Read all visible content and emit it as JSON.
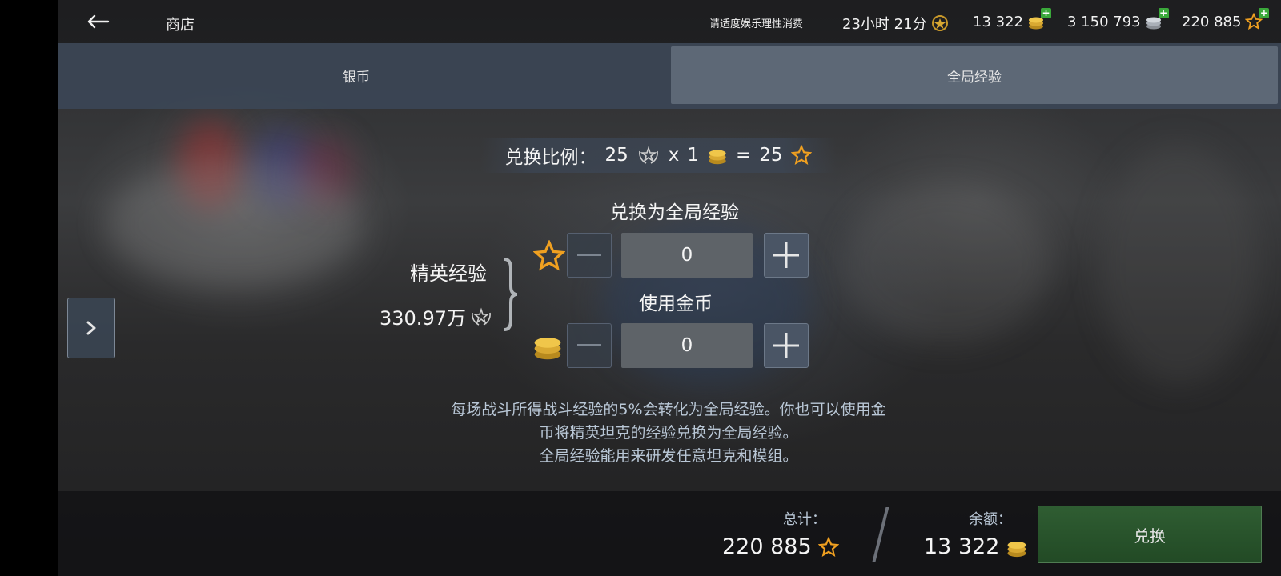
{
  "header": {
    "title": "商店",
    "notice": "请适度娱乐理性消费",
    "timer": "23小时 21分",
    "gold": "13 322",
    "silver": "3 150 793",
    "free_xp": "220 885"
  },
  "tabs": [
    {
      "label": "银币",
      "active": false
    },
    {
      "label": "全局经验",
      "active": true
    }
  ],
  "rate": {
    "label": "兑换比例：",
    "xp_amount": "25",
    "times": "x",
    "gold_amount": "1",
    "equals": "=",
    "result": "25"
  },
  "convert": {
    "heading_xp": "兑换为全局经验",
    "xp_value": "0",
    "heading_gold": "使用金币",
    "gold_value": "0"
  },
  "elite": {
    "label": "精英经验",
    "value": "330.97万"
  },
  "description": {
    "line1": "每场战斗所得战斗经验的5%会转化为全局经验。你也可以使用金",
    "line2": "币将精英坦克的经验兑换为全局经验。",
    "line3": "全局经验能用来研发任意坦克和模组。"
  },
  "footer": {
    "total_label": "总计：",
    "total_value": "220 885",
    "balance_label": "余额：",
    "balance_value": "13 322",
    "exchange_label": "兑换"
  },
  "colors": {
    "accent_star": "#f0a020",
    "gold": "#e6b43c",
    "button_green": "#2f5d32",
    "tab_active": "#5d6876"
  }
}
